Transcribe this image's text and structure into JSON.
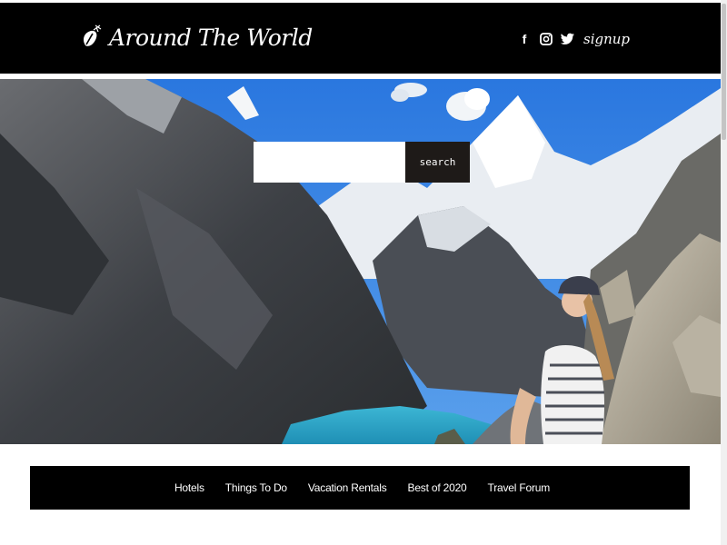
{
  "brand": {
    "title": "Around The World",
    "logo_icon": "leaf-logo-icon"
  },
  "social": {
    "facebook_icon": "f",
    "instagram_icon": "instagram-icon",
    "twitter_icon": "twitter-icon",
    "signup_label": "signup"
  },
  "search": {
    "button_label": "search",
    "placeholder": ""
  },
  "nav": {
    "items": [
      {
        "label": "Hotels"
      },
      {
        "label": "Things To Do"
      },
      {
        "label": "Vacation Rentals"
      },
      {
        "label": "Best of 2020"
      },
      {
        "label": "Travel Forum"
      }
    ]
  },
  "colors": {
    "header_bg": "#000000",
    "search_button_bg": "#1e1a18",
    "nav_bg": "#000000",
    "lake": "#2aa6c8",
    "sky": "#2f7fe0"
  }
}
